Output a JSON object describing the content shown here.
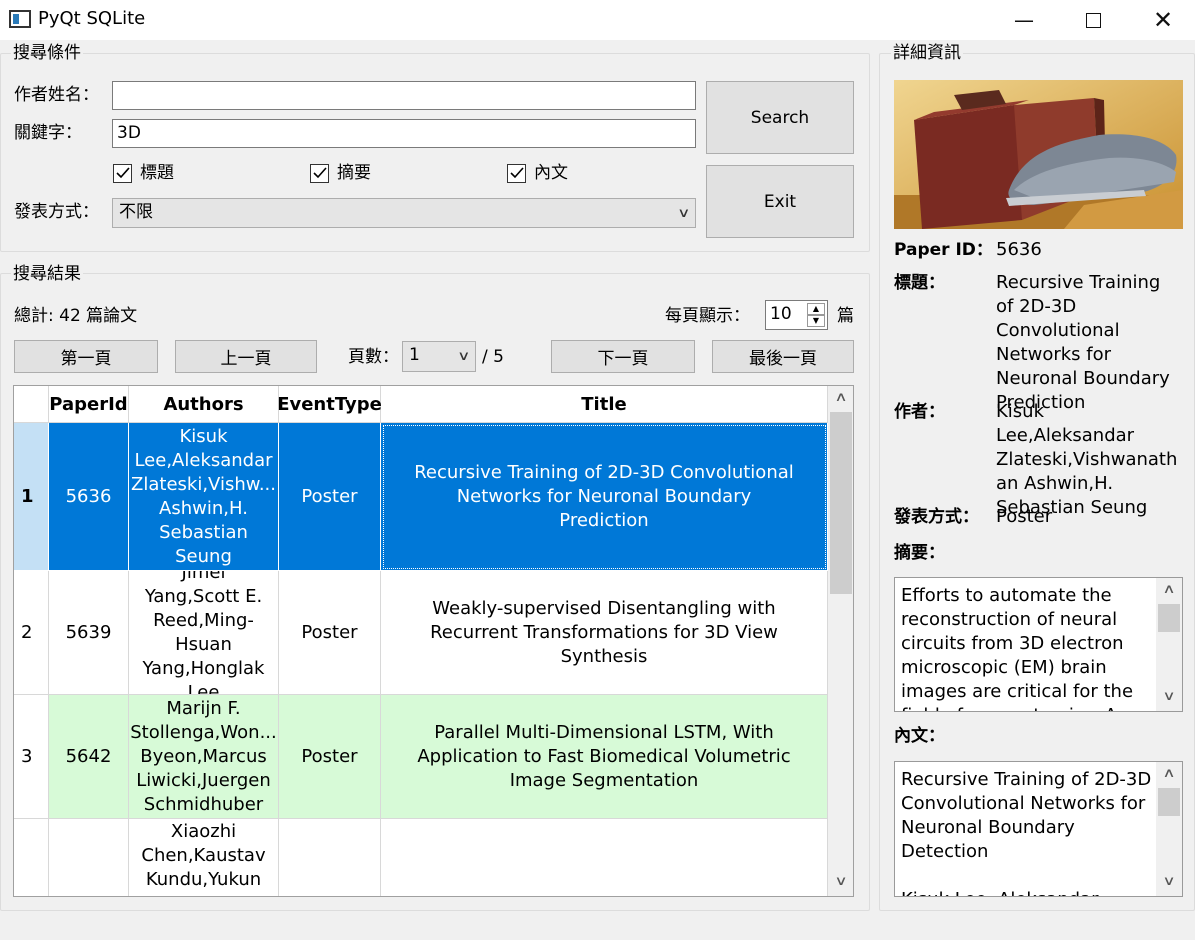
{
  "window": {
    "title": "PyQt SQLite",
    "icon": "app-window-icon",
    "controls": [
      "minimize-icon",
      "maximize-icon",
      "close-icon"
    ]
  },
  "search": {
    "group_title": "搜尋條件",
    "author_label": "作者姓名：",
    "author_value": "",
    "keyword_label": "關鍵字：",
    "keyword_value": "3D",
    "checks": [
      {
        "label": "標題",
        "checked": true
      },
      {
        "label": "摘要",
        "checked": true
      },
      {
        "label": "內文",
        "checked": true
      }
    ],
    "type_label": "發表方式：",
    "type_value": "不限",
    "search_button": "Search",
    "exit_button": "Exit"
  },
  "results": {
    "group_title": "搜尋結果",
    "total": "總計: 42 篇論文",
    "per_page_label": "每頁顯示：",
    "per_page_value": "10",
    "per_page_unit": "篇",
    "first_button": "第一頁",
    "prev_button": "上一頁",
    "page_label": "頁數：",
    "page_value": "1",
    "page_total": "/ 5",
    "next_button": "下一頁",
    "last_button": "最後一頁",
    "columns": [
      "PaperId",
      "Authors",
      "EventType",
      "Title"
    ],
    "rows": [
      {
        "num": "1",
        "id": "5636",
        "authors": "Kisuk Lee,Aleksandar Zlateski,Vishw... Ashwin,H. Sebastian Seung",
        "type": "Poster",
        "title": "Recursive Training of 2D-3D Convolutional Networks for Neuronal Boundary Prediction"
      },
      {
        "num": "2",
        "id": "5639",
        "authors": "Jimei Yang,Scott E. Reed,Ming-Hsuan Yang,Honglak Lee",
        "type": "Poster",
        "title": "Weakly-supervised Disentangling with Recurrent Transformations for 3D View Synthesis"
      },
      {
        "num": "3",
        "id": "5642",
        "authors": "Marijn F. Stollenga,Won... Byeon,Marcus Liwicki,Juergen Schmidhuber",
        "type": "Poster",
        "title": "Parallel Multi-Dimensional LSTM, With Application to Fast Biomedical Volumetric Image Segmentation"
      },
      {
        "num": "",
        "id": "",
        "authors": "Xiaozhi Chen,Kaustav Kundu,Yukun",
        "type": "",
        "title": ""
      }
    ]
  },
  "details": {
    "group_title": "詳細資訊",
    "paper_id_label": "Paper ID：",
    "paper_id": "5636",
    "title_label": "標題：",
    "title": "Recursive Training of 2D-3D Convolutional Networks for Neuronal Boundary Prediction",
    "author_label": "作者：",
    "authors": "Kisuk Lee,Aleksandar Zlateski,Vishwanathan Ashwin,H. Sebastian Seung",
    "type_label": "發表方式：",
    "type": "Poster",
    "abstract_label": "摘要：",
    "abstract": "Efforts to automate the reconstruction of neural circuits from 3D electron microscopic (EM) brain images are critical for the field of connectomics. An",
    "content_label": "內文：",
    "content": "Recursive Training of 2D-3D Convolutional Networks for Neuronal Boundary Detection\n\nKisuk Lee, Aleksandar"
  }
}
